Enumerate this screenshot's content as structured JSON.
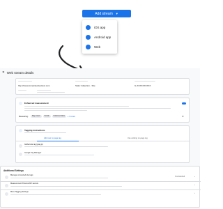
{
  "dropdown": {
    "button_label": "Add stream",
    "items": [
      {
        "label": "iOS app",
        "icon": "apple-icon"
      },
      {
        "label": "Android app",
        "icon": "android-icon"
      },
      {
        "label": "Web",
        "icon": "globe-icon"
      }
    ]
  },
  "panel": {
    "title": "Web stream details",
    "stream_url": "http://www.domaintexttexttext.com",
    "stream_name": "Stats Collection - Site",
    "measurement_id": "G-XXXXXXXXXX",
    "enhanced_measurement": "Enhanced measurement",
    "measuring": "Measuring:",
    "chips": [
      "Page views",
      "Scrolls",
      "Outbound clicks"
    ],
    "more": "+ 3 more",
    "tagging_instructions": "Tagging instructions",
    "tab_add_new": "Add new on-page tag",
    "tab_existing": "Use existing on-page tag",
    "global_site_tag": "Global site tag (gtag.js)",
    "gtm": "Google Tag Manager",
    "additional_settings": "Additional Settings",
    "settings": [
      {
        "title": "Manage connected site tags"
      },
      {
        "title": "Measurement Protocol API secrets"
      },
      {
        "title": "More Tagging Settings"
      }
    ],
    "connected_count": "0 connected"
  }
}
